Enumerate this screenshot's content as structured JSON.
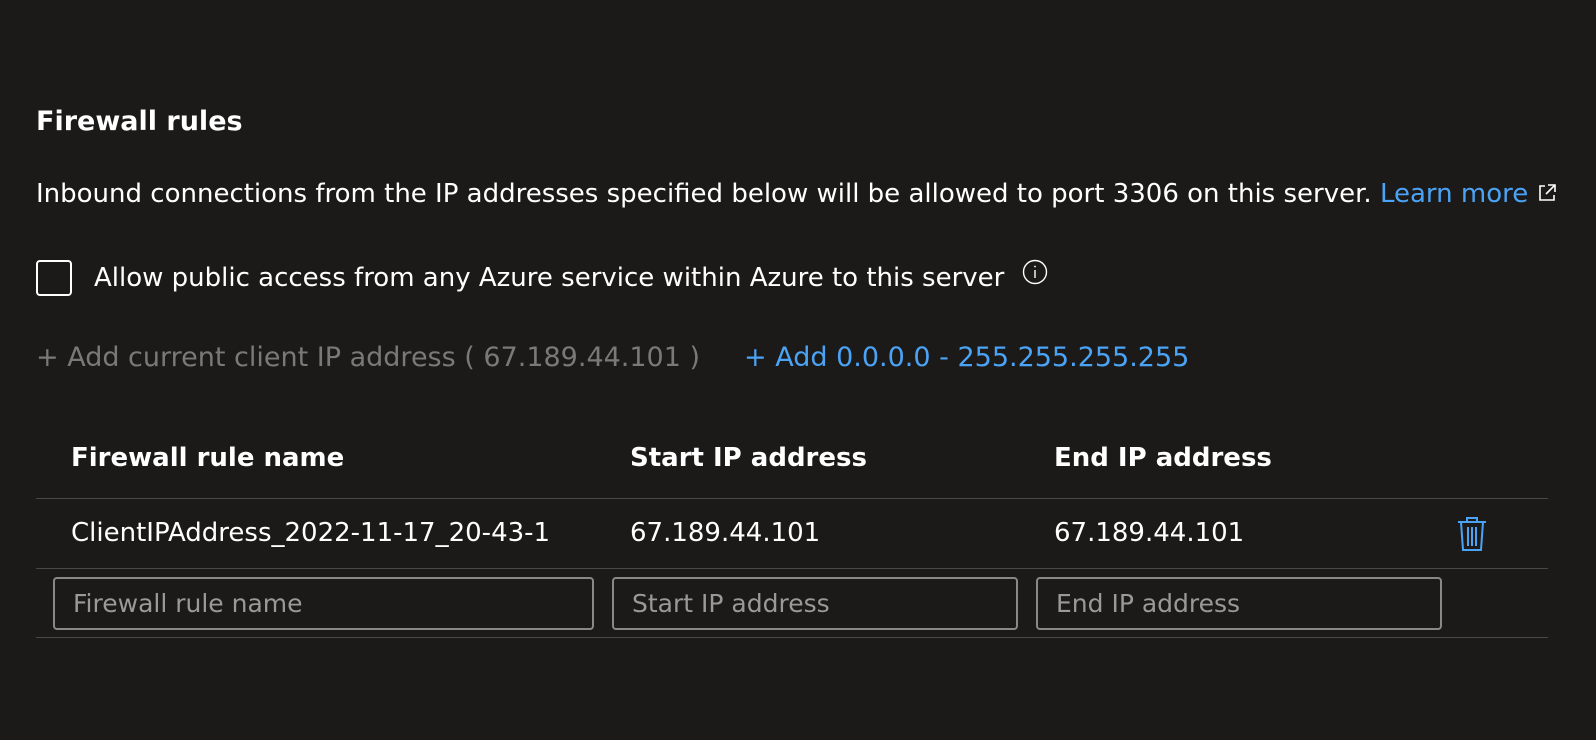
{
  "section": {
    "title": "Firewall rules",
    "description": "Inbound connections from the IP addresses specified below will be allowed to port 3306 on this server.",
    "learn_more": "Learn more"
  },
  "azure_access": {
    "label": "Allow public access from any Azure service within Azure to this server",
    "checked": false
  },
  "actions": {
    "add_client_ip": "+ Add current client IP address ( 67.189.44.101 )",
    "add_all_ips": "+ Add 0.0.0.0 - 255.255.255.255"
  },
  "table": {
    "headers": [
      "Firewall rule name",
      "Start IP address",
      "End IP address"
    ],
    "rows": [
      {
        "name": "ClientIPAddress_2022-11-17_20-43-1",
        "start_ip": "67.189.44.101",
        "end_ip": "67.189.44.101"
      }
    ],
    "new_rule": {
      "name_placeholder": "Firewall rule name",
      "start_placeholder": "Start IP address",
      "end_placeholder": "End IP address"
    }
  },
  "icons": {
    "external_link": "external-link-icon",
    "info": "info-icon",
    "delete": "trash-icon"
  },
  "colors": {
    "background": "#1b1a19",
    "link": "#4ba3f5",
    "disabled": "#7a7978",
    "divider": "#4a4847"
  }
}
